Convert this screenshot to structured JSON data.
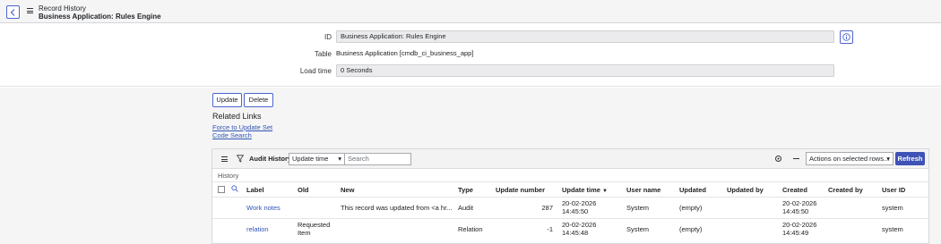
{
  "header": {
    "title": "Record History",
    "subtitle": "Business Application: Rules Engine"
  },
  "form": {
    "id_label": "ID",
    "id_value": "Business Application: Rules Engine",
    "table_label": "Table",
    "table_value": "Business Application [cmdb_ci_business_app]",
    "load_label": "Load time",
    "load_value": "0 Seconds"
  },
  "actions": {
    "update_label": "Update",
    "delete_label": "Delete"
  },
  "related": {
    "title": "Related Links",
    "links": [
      "Force to Update Set",
      "Code Search"
    ]
  },
  "list": {
    "title": "Audit History",
    "filter_field": "Update time",
    "search_placeholder": "Search",
    "actions_select": "Actions on selected rows...",
    "refresh_label": "Refresh",
    "breadcrumb": "History",
    "columns": [
      "Label",
      "Old",
      "New",
      "Type",
      "Update number",
      "Update time",
      "User name",
      "Updated",
      "Updated by",
      "Created",
      "Created by",
      "User ID"
    ],
    "sort_indicator": "▼",
    "rows": [
      {
        "label": "Work notes",
        "old": "",
        "new": "This record was updated from <a hr...",
        "type": "Audit",
        "update_number": "287",
        "update_time_date": "20-02-2026",
        "update_time_clock": "14:45:50",
        "user_name": "System",
        "updated": "(empty)",
        "updated_by": "",
        "created_date": "20-02-2026",
        "created_clock": "14:45:50",
        "created_by": "",
        "user_id": "system"
      },
      {
        "label": "relation",
        "old_line1": "Requested",
        "old_line2": "Item",
        "new": "",
        "type": "Relation",
        "update_number": "-1",
        "update_time_date": "20-02-2026",
        "update_time_clock": "14:45:48",
        "user_name": "System",
        "updated": "(empty)",
        "updated_by": "",
        "created_date": "20-02-2026",
        "created_clock": "14:45:49",
        "created_by": "",
        "user_id": "system"
      }
    ]
  },
  "icons": {
    "back": "chevron-left-icon",
    "menu": "hamburger-icon",
    "info": "info-icon",
    "filter": "filter-icon",
    "search": "search-icon",
    "settings": "gear-icon",
    "collapse": "minus-icon"
  },
  "colors": {
    "accent": "#3f52b5",
    "link": "#3156b5"
  }
}
